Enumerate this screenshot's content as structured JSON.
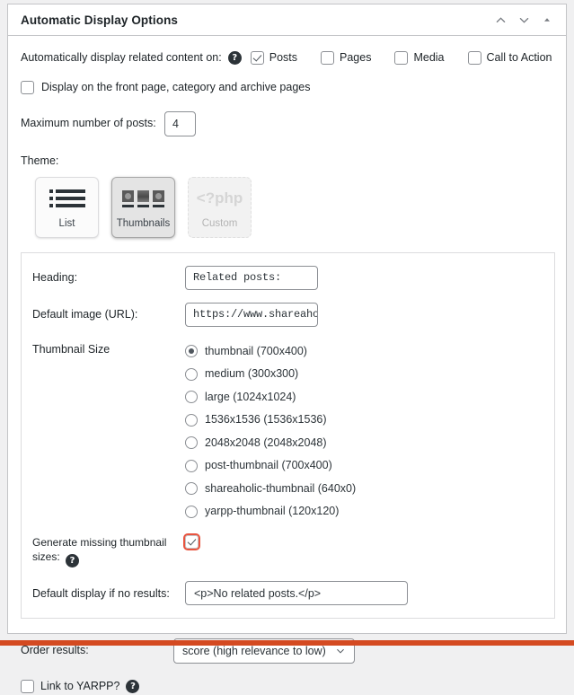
{
  "panel": {
    "title": "Automatic Display Options",
    "header_icons": [
      {
        "name": "move-up-icon",
        "glyph": "chevron-up"
      },
      {
        "name": "move-down-icon",
        "glyph": "chevron-down"
      },
      {
        "name": "toggle-panel-icon",
        "glyph": "triangle-up"
      }
    ]
  },
  "auto_display": {
    "label": "Automatically display related content on:",
    "help": "?",
    "options": [
      {
        "label": "Posts",
        "checked": true
      },
      {
        "label": "Pages",
        "checked": false
      },
      {
        "label": "Media",
        "checked": false
      },
      {
        "label": "Call to Action",
        "checked": false
      }
    ]
  },
  "front_page": {
    "label": "Display on the front page, category and archive pages",
    "checked": false
  },
  "max_posts": {
    "label": "Maximum number of posts:",
    "value": "4"
  },
  "theme": {
    "label": "Theme:",
    "cards": [
      {
        "name": "List",
        "selected": false,
        "disabled": false,
        "icon": "list-theme-icon"
      },
      {
        "name": "Thumbnails",
        "selected": true,
        "disabled": false,
        "icon": "thumbnails-theme-icon"
      },
      {
        "name": "Custom",
        "selected": false,
        "disabled": true,
        "icon": "php-theme-icon",
        "icon_text": "<?php"
      }
    ]
  },
  "heading": {
    "label": "Heading:",
    "value": "Related posts:"
  },
  "default_image": {
    "label": "Default image (URL):",
    "value": "https://www.shareaholic.net/"
  },
  "thumbnail_size": {
    "label": "Thumbnail Size",
    "selected": "thumbnail (700x400)",
    "options": [
      {
        "label": "thumbnail (700x400)",
        "checked": true
      },
      {
        "label": "medium (300x300)",
        "checked": false
      },
      {
        "label": "large (1024x1024)",
        "checked": false
      },
      {
        "label": "1536x1536 (1536x1536)",
        "checked": false
      },
      {
        "label": "2048x2048 (2048x2048)",
        "checked": false
      },
      {
        "label": "post-thumbnail (700x400)",
        "checked": false
      },
      {
        "label": "shareaholic-thumbnail (640x0)",
        "checked": false
      },
      {
        "label": "yarpp-thumbnail (120x120)",
        "checked": false
      }
    ]
  },
  "generate_thumbs": {
    "label": "Generate missing thumbnail sizes:",
    "help": "?",
    "checked": true,
    "highlight_color": "#e8543f"
  },
  "no_results": {
    "label": "Default display if no results:",
    "value": "<p>No related posts.</p>"
  },
  "order_results": {
    "label": "Order results:",
    "value": "score (high relevance to low)"
  },
  "link_yarpp": {
    "label": "Link to YARPP?",
    "help": "?",
    "checked": false
  },
  "accent": {
    "bottom_bar_color": "#d44a21"
  }
}
